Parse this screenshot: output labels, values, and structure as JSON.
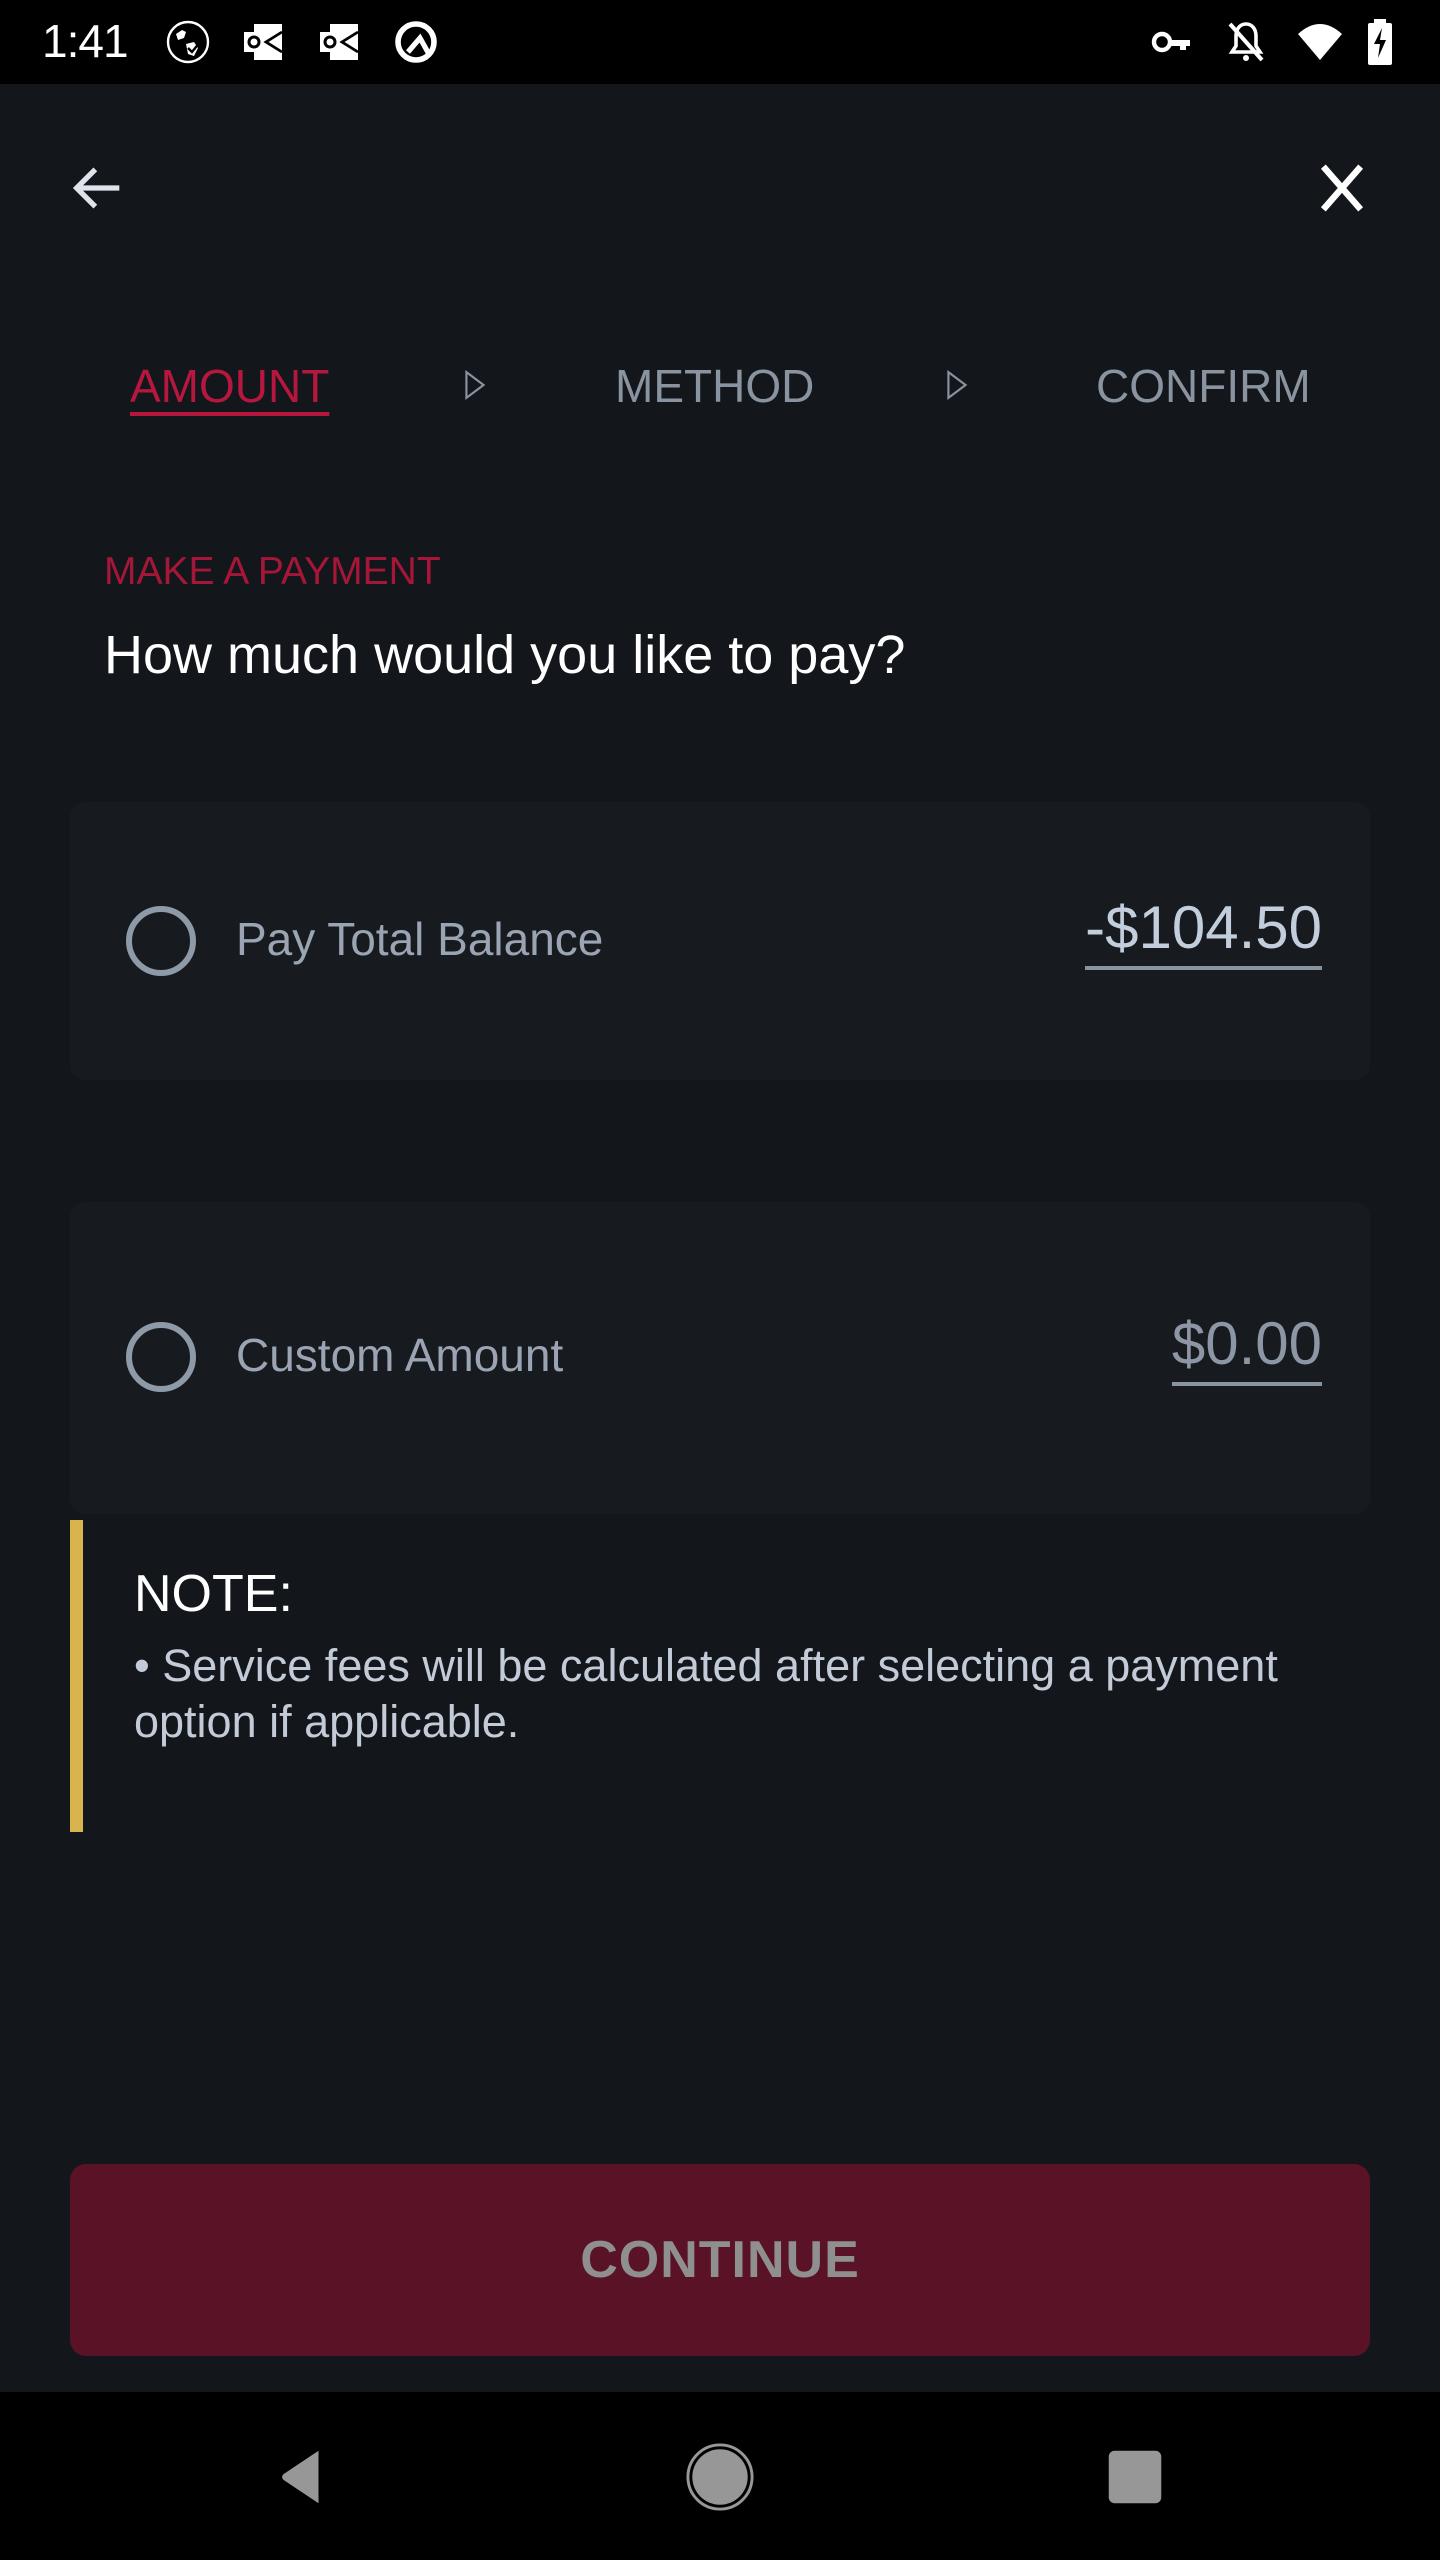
{
  "status_bar": {
    "time": "1:41",
    "left_icons": [
      "globe-check-icon",
      "outlook-icon",
      "outlook-icon",
      "q-icon"
    ],
    "right_icons": [
      "vpn-key-icon",
      "notifications-off-icon",
      "wifi-icon",
      "battery-charging-icon"
    ]
  },
  "header": {
    "back_icon": "arrow-left-icon",
    "close_icon": "close-icon"
  },
  "stepper": {
    "steps": [
      {
        "label": "AMOUNT",
        "active": true
      },
      {
        "label": "METHOD",
        "active": false
      },
      {
        "label": "CONFIRM",
        "active": false
      }
    ],
    "separator_icon": "triangle-right-outline-icon"
  },
  "main": {
    "eyebrow": "MAKE A PAYMENT",
    "headline": "How much would you like to pay?",
    "options": [
      {
        "label": "Pay Total Balance",
        "amount": "-$104.50",
        "selected": false
      },
      {
        "label": "Custom Amount",
        "amount": "$0.00",
        "selected": false
      }
    ],
    "note": {
      "title": "NOTE:",
      "body": "• Service fees will be calculated after selecting a payment option if applicable."
    },
    "continue_label": "CONTINUE"
  },
  "colors": {
    "accent": "#b5173f",
    "button_bg": "#591226",
    "note_bar": "#d9b34e",
    "background": "#13171b",
    "card": "#171b20"
  },
  "nav_bar": {
    "icons": [
      "nav-back-icon",
      "nav-home-icon",
      "nav-recents-icon"
    ]
  }
}
